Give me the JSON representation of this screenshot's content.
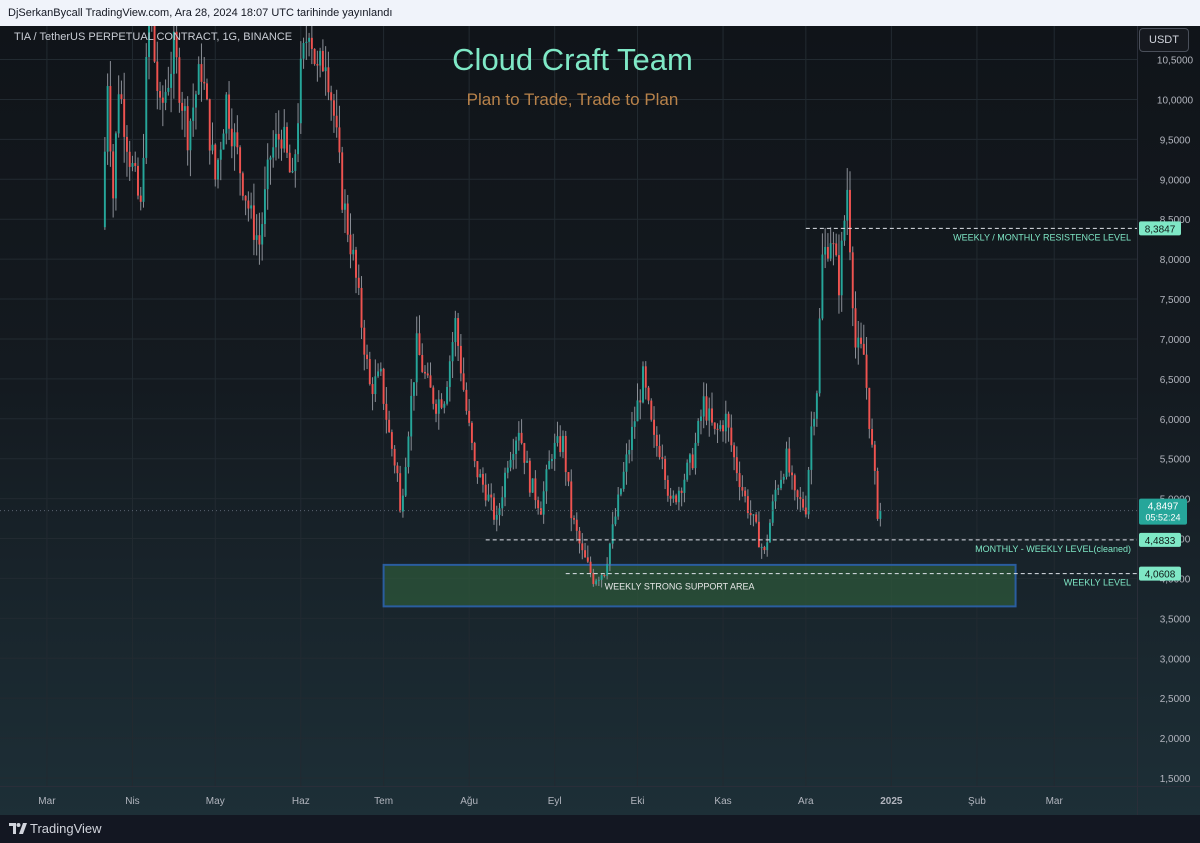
{
  "header": {
    "publish_text": "DjSerkanBycall TradingView.com, Ara 28, 2024 18:07 UTC tarihinde yayınlandı"
  },
  "symbol": {
    "line": "TIA / TetherUS PERPETUAL CONTRACT, 1G, BINANCE"
  },
  "brand": {
    "title": "Cloud Craft Team",
    "subtitle": "Plan to Trade, Trade to Plan"
  },
  "currency_button": "USDT",
  "footer": {
    "brand": "TradingView"
  },
  "colors": {
    "up": "#26a69a",
    "down": "#ef5350",
    "wick": "#8a8e96",
    "accent": "#7fe8c6",
    "support_fill": "#2f5d3c",
    "support_border": "#2a5d9f"
  },
  "chart_data": {
    "type": "candlestick",
    "title": "Cloud Craft Team",
    "subtitle": "Plan to Trade, Trade to Plan",
    "timeframe": "1G",
    "x_start": "2024-02-13",
    "x_end": "2025-03-31",
    "xticks": [
      {
        "label": "Mar",
        "date": "2024-03-01"
      },
      {
        "label": "Nis",
        "date": "2024-04-01"
      },
      {
        "label": "May",
        "date": "2024-05-01"
      },
      {
        "label": "Haz",
        "date": "2024-06-01"
      },
      {
        "label": "Tem",
        "date": "2024-07-01"
      },
      {
        "label": "Ağu",
        "date": "2024-08-01"
      },
      {
        "label": "Eyl",
        "date": "2024-09-01"
      },
      {
        "label": "Eki",
        "date": "2024-10-01"
      },
      {
        "label": "Kas",
        "date": "2024-11-01"
      },
      {
        "label": "Ara",
        "date": "2024-12-01"
      },
      {
        "label": "2025",
        "date": "2025-01-01",
        "bold": true
      },
      {
        "label": "Şub",
        "date": "2025-02-01"
      },
      {
        "label": "Mar",
        "date": "2025-03-01"
      }
    ],
    "ylim": [
      1.4,
      10.92
    ],
    "yticks": [
      {
        "v": 1.5,
        "label": "1,5000"
      },
      {
        "v": 2.0,
        "label": "2,0000"
      },
      {
        "v": 2.5,
        "label": "2,5000"
      },
      {
        "v": 3.0,
        "label": "3,0000"
      },
      {
        "v": 3.5,
        "label": "3,5000"
      },
      {
        "v": 4.0,
        "label": "4,0000"
      },
      {
        "v": 4.5,
        "label": "4,5000"
      },
      {
        "v": 5.0,
        "label": "5,0000"
      },
      {
        "v": 5.5,
        "label": "5,5000"
      },
      {
        "v": 6.0,
        "label": "6,0000"
      },
      {
        "v": 6.5,
        "label": "6,5000"
      },
      {
        "v": 7.0,
        "label": "7,0000"
      },
      {
        "v": 7.5,
        "label": "7,5000"
      },
      {
        "v": 8.0,
        "label": "8,0000"
      },
      {
        "v": 8.5,
        "label": "8,5000"
      },
      {
        "v": 9.0,
        "label": "9,0000"
      },
      {
        "v": 9.5,
        "label": "9,5000"
      },
      {
        "v": 10.0,
        "label": "10,0000"
      },
      {
        "v": 10.5,
        "label": "10,5000"
      }
    ],
    "price_points": [
      [
        "2024-03-22",
        8.4
      ],
      [
        "2024-03-24",
        10.3
      ],
      [
        "2024-03-26",
        8.8
      ],
      [
        "2024-03-28",
        10.2
      ],
      [
        "2024-04-01",
        9.3
      ],
      [
        "2024-04-05",
        8.6
      ],
      [
        "2024-04-08",
        11.2
      ],
      [
        "2024-04-12",
        9.8
      ],
      [
        "2024-04-17",
        10.6
      ],
      [
        "2024-04-22",
        9.6
      ],
      [
        "2024-04-27",
        10.4
      ],
      [
        "2024-05-02",
        9.0
      ],
      [
        "2024-05-06",
        10.0
      ],
      [
        "2024-05-10",
        9.3
      ],
      [
        "2024-05-15",
        8.5
      ],
      [
        "2024-05-18",
        8.2
      ],
      [
        "2024-05-22",
        9.3
      ],
      [
        "2024-05-26",
        9.6
      ],
      [
        "2024-05-30",
        8.9
      ],
      [
        "2024-06-02",
        10.3
      ],
      [
        "2024-06-05",
        11.0
      ],
      [
        "2024-06-08",
        10.3
      ],
      [
        "2024-06-11",
        10.6
      ],
      [
        "2024-06-14",
        9.8
      ],
      [
        "2024-06-17",
        8.8
      ],
      [
        "2024-06-21",
        8.0
      ],
      [
        "2024-06-24",
        7.2
      ],
      [
        "2024-06-27",
        6.4
      ],
      [
        "2024-07-01",
        6.5
      ],
      [
        "2024-07-04",
        5.8
      ],
      [
        "2024-07-07",
        5.3
      ],
      [
        "2024-07-08",
        4.8
      ],
      [
        "2024-07-11",
        5.9
      ],
      [
        "2024-07-14",
        6.9
      ],
      [
        "2024-07-18",
        6.4
      ],
      [
        "2024-07-21",
        6.2
      ],
      [
        "2024-07-24",
        6.3
      ],
      [
        "2024-07-28",
        7.2
      ],
      [
        "2024-08-01",
        6.1
      ],
      [
        "2024-08-04",
        5.4
      ],
      [
        "2024-08-08",
        5.1
      ],
      [
        "2024-08-12",
        4.7
      ],
      [
        "2024-08-16",
        5.5
      ],
      [
        "2024-08-20",
        5.9
      ],
      [
        "2024-08-24",
        5.2
      ],
      [
        "2024-08-28",
        4.9
      ],
      [
        "2024-09-01",
        5.6
      ],
      [
        "2024-09-05",
        5.7
      ],
      [
        "2024-09-08",
        4.8
      ],
      [
        "2024-09-12",
        4.3
      ],
      [
        "2024-09-16",
        4.0
      ],
      [
        "2024-09-20",
        4.1
      ],
      [
        "2024-09-23",
        4.6
      ],
      [
        "2024-09-27",
        5.3
      ],
      [
        "2024-10-01",
        6.0
      ],
      [
        "2024-10-04",
        6.5
      ],
      [
        "2024-10-08",
        5.7
      ],
      [
        "2024-10-11",
        5.6
      ],
      [
        "2024-10-14",
        4.9
      ],
      [
        "2024-10-18",
        5.2
      ],
      [
        "2024-10-22",
        5.5
      ],
      [
        "2024-10-26",
        6.2
      ],
      [
        "2024-10-30",
        5.8
      ],
      [
        "2024-11-03",
        6.0
      ],
      [
        "2024-11-06",
        5.5
      ],
      [
        "2024-11-10",
        5.0
      ],
      [
        "2024-11-14",
        4.6
      ],
      [
        "2024-11-17",
        4.3
      ],
      [
        "2024-11-21",
        5.1
      ],
      [
        "2024-11-25",
        5.5
      ],
      [
        "2024-11-28",
        5.0
      ],
      [
        "2024-12-02",
        4.9
      ],
      [
        "2024-12-04",
        5.9
      ],
      [
        "2024-12-06",
        6.4
      ],
      [
        "2024-12-08",
        8.0
      ],
      [
        "2024-12-11",
        8.3
      ],
      [
        "2024-12-14",
        7.7
      ],
      [
        "2024-12-17",
        8.9
      ],
      [
        "2024-12-20",
        6.9
      ],
      [
        "2024-12-23",
        6.8
      ],
      [
        "2024-12-26",
        5.6
      ],
      [
        "2024-12-28",
        4.85
      ]
    ],
    "current_price": {
      "label": "4,8497",
      "countdown": "05:52:24",
      "value": 4.8497
    },
    "levels": [
      {
        "name": "WEEKLY / MONTHLY RESISTENCE LEVEL",
        "price": 8.3847,
        "label": "8,3847",
        "from": "2024-12-01",
        "to": "2025-03-31"
      },
      {
        "name": "MONTHLY - WEEKLY LEVEL(cleaned)",
        "price": 4.4833,
        "label": "4,4833",
        "from": "2024-08-07",
        "to": "2025-03-31"
      },
      {
        "name": "WEEKLY LEVEL",
        "price": 4.0608,
        "label": "4,0608",
        "from": "2024-09-05",
        "to": "2025-03-31"
      }
    ],
    "zones": [
      {
        "name": "WEEKLY STRONG SUPPORT AREA",
        "from": "2024-07-01",
        "to": "2025-02-15",
        "low": 3.65,
        "high": 4.17
      }
    ]
  }
}
